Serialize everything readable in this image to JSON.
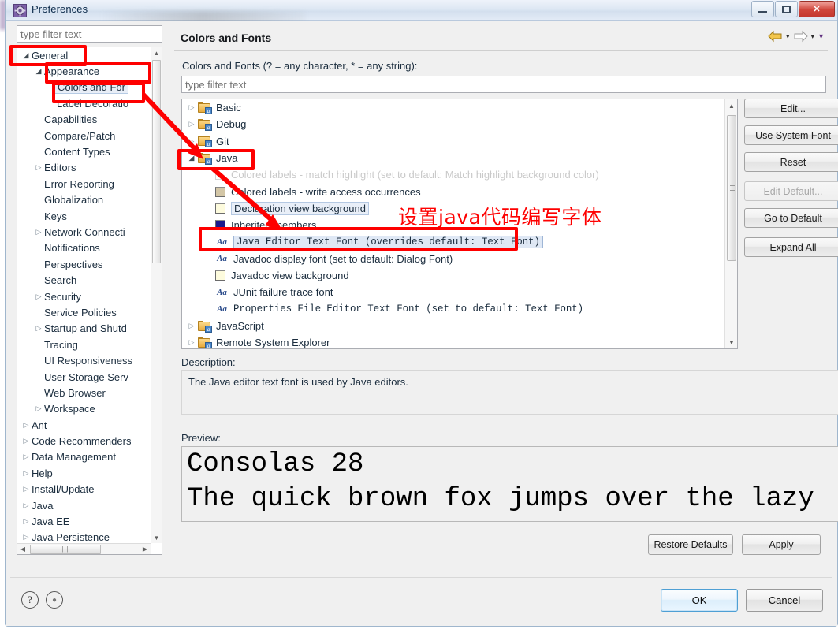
{
  "window": {
    "title": "Preferences",
    "icon": "preferences-gear-icon",
    "controls": {
      "minimize": "minimize-icon",
      "maximize": "maximize-icon",
      "close": "✕"
    }
  },
  "left_panel": {
    "filter_placeholder": "type filter text",
    "tree": [
      {
        "label": "General",
        "indent": 0,
        "arrow": "open"
      },
      {
        "label": "Appearance",
        "indent": 1,
        "arrow": "open"
      },
      {
        "label": "Colors and For",
        "indent": 2,
        "arrow": "none",
        "selected": true
      },
      {
        "label": "Label Decoratio",
        "indent": 2,
        "arrow": "none"
      },
      {
        "label": "Capabilities",
        "indent": 1,
        "arrow": "none"
      },
      {
        "label": "Compare/Patch",
        "indent": 1,
        "arrow": "none"
      },
      {
        "label": "Content Types",
        "indent": 1,
        "arrow": "none"
      },
      {
        "label": "Editors",
        "indent": 1,
        "arrow": "closed"
      },
      {
        "label": "Error Reporting",
        "indent": 1,
        "arrow": "none"
      },
      {
        "label": "Globalization",
        "indent": 1,
        "arrow": "none"
      },
      {
        "label": "Keys",
        "indent": 1,
        "arrow": "none"
      },
      {
        "label": "Network Connecti",
        "indent": 1,
        "arrow": "closed"
      },
      {
        "label": "Notifications",
        "indent": 1,
        "arrow": "none"
      },
      {
        "label": "Perspectives",
        "indent": 1,
        "arrow": "none"
      },
      {
        "label": "Search",
        "indent": 1,
        "arrow": "none"
      },
      {
        "label": "Security",
        "indent": 1,
        "arrow": "closed"
      },
      {
        "label": "Service Policies",
        "indent": 1,
        "arrow": "none"
      },
      {
        "label": "Startup and Shutd",
        "indent": 1,
        "arrow": "closed"
      },
      {
        "label": "Tracing",
        "indent": 1,
        "arrow": "none"
      },
      {
        "label": "UI Responsiveness",
        "indent": 1,
        "arrow": "none"
      },
      {
        "label": "User Storage Serv",
        "indent": 1,
        "arrow": "none"
      },
      {
        "label": "Web Browser",
        "indent": 1,
        "arrow": "none"
      },
      {
        "label": "Workspace",
        "indent": 1,
        "arrow": "closed"
      },
      {
        "label": "Ant",
        "indent": 0,
        "arrow": "closed"
      },
      {
        "label": "Code Recommenders",
        "indent": 0,
        "arrow": "closed"
      },
      {
        "label": "Data Management",
        "indent": 0,
        "arrow": "closed"
      },
      {
        "label": "Help",
        "indent": 0,
        "arrow": "closed"
      },
      {
        "label": "Install/Update",
        "indent": 0,
        "arrow": "closed"
      },
      {
        "label": "Java",
        "indent": 0,
        "arrow": "closed"
      },
      {
        "label": "Java EE",
        "indent": 0,
        "arrow": "closed"
      },
      {
        "label": "Java Persistence",
        "indent": 0,
        "arrow": "closed"
      }
    ]
  },
  "right_panel": {
    "page_title": "Colors and Fonts",
    "sub_label": "Colors and Fonts (? = any character, * = any string):",
    "filter_placeholder": "type filter text",
    "nav": {
      "back_icon": "back-arrow-icon",
      "back_caret": "▾",
      "forward_icon": "forward-arrow-icon",
      "forward_caret": "▾",
      "menu_caret": "▼"
    },
    "tree": [
      {
        "label": "Basic",
        "type": "folder",
        "arrow": "closed",
        "indent": 0
      },
      {
        "label": "Debug",
        "type": "folder",
        "arrow": "closed",
        "indent": 0
      },
      {
        "label": "Git",
        "type": "folder",
        "arrow": "closed",
        "indent": 0
      },
      {
        "label": "Java",
        "type": "folder",
        "arrow": "open",
        "indent": 0
      },
      {
        "label": "Colored labels - match highlight (set to default: Match highlight background color)",
        "type": "swatch",
        "color": "#ffffff",
        "indent": 1,
        "disabled": true
      },
      {
        "label": "Colored labels - write access occurrences",
        "type": "swatch",
        "color": "#d3c6a6",
        "indent": 1
      },
      {
        "label": "Declaration view background",
        "type": "swatch",
        "color": "#fdfbdd",
        "indent": 1,
        "boxed": true
      },
      {
        "label": "Inherited members",
        "type": "swatch",
        "color": "#1a1a8c",
        "indent": 1
      },
      {
        "label": "Java Editor Text Font (overrides default: Text Font)",
        "type": "font",
        "indent": 1,
        "selected": true,
        "mono": true
      },
      {
        "label": "Javadoc display font (set to default: Dialog Font)",
        "type": "font",
        "indent": 1
      },
      {
        "label": "Javadoc view background",
        "type": "swatch",
        "color": "#fdfbdd",
        "indent": 1
      },
      {
        "label": "JUnit failure trace font",
        "type": "font",
        "indent": 1
      },
      {
        "label": "Properties File Editor Text Font (set to default: Text Font)",
        "type": "font",
        "indent": 1,
        "mono": true
      },
      {
        "label": "JavaScript",
        "type": "folder",
        "arrow": "closed",
        "indent": 0
      },
      {
        "label": "Remote System Explorer",
        "type": "folder",
        "arrow": "closed",
        "indent": 0
      }
    ],
    "buttons": [
      {
        "label": "Edit...",
        "disabled": false
      },
      {
        "label": "Use System Font",
        "disabled": false
      },
      {
        "label": "Reset",
        "disabled": false
      },
      {
        "label": "Edit Default...",
        "disabled": true
      },
      {
        "label": "Go to Default",
        "disabled": false
      },
      {
        "label": "Expand All",
        "disabled": false
      }
    ],
    "description_label": "Description:",
    "description_text": "The Java editor text font is used by Java editors.",
    "preview_label": "Preview:",
    "preview_line1": "Consolas 28",
    "preview_line2": "The quick brown fox jumps over the lazy",
    "restore_defaults_label": "Restore Defaults",
    "apply_label": "Apply"
  },
  "footer": {
    "help_icon": "?",
    "pin_icon": "●",
    "ok_label": "OK",
    "cancel_label": "Cancel"
  },
  "annotation": {
    "note_text": "设置java代码编写字体",
    "color": "#fe0000"
  }
}
